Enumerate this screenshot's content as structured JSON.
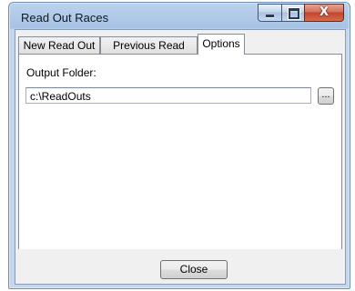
{
  "window": {
    "title": "Read Out Races",
    "close_glyph": "X"
  },
  "tabs": [
    {
      "label": "New Read Out"
    },
    {
      "label": "Previous Read Outs"
    },
    {
      "label": "Options",
      "selected": true
    }
  ],
  "options": {
    "output_folder_label": "Output Folder:",
    "output_folder_value": "c:\\ReadOuts",
    "browse_label": "..."
  },
  "footer": {
    "close_label": "Close"
  },
  "colors": {
    "titlebar": "#a7c2e4",
    "close_button": "#c3452b",
    "panel": "#ffffff",
    "dialog_bg": "#f0f0f0"
  },
  "icons": {
    "minimize": "minimize-icon",
    "maximize": "maximize-icon",
    "close": "close-icon"
  }
}
